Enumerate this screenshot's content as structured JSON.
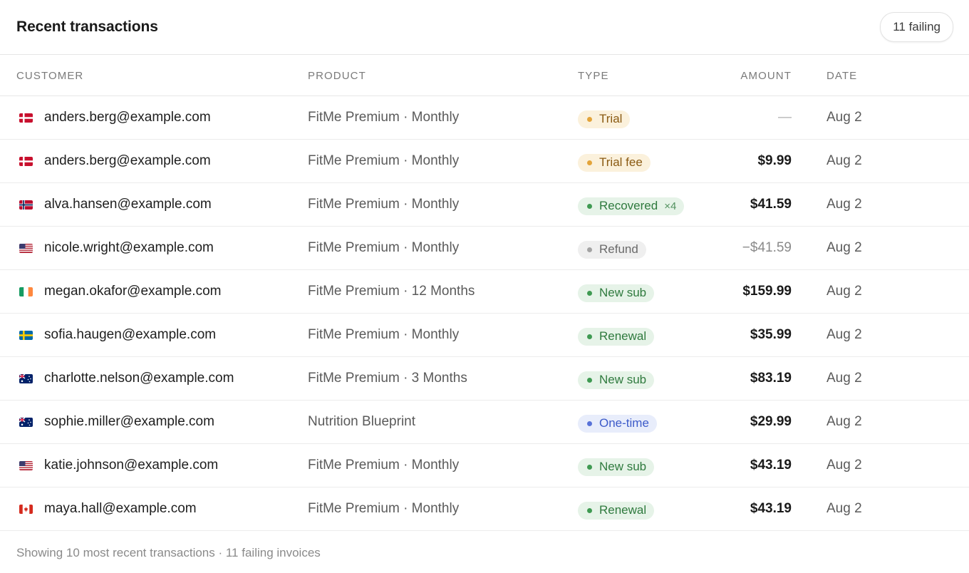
{
  "header": {
    "title": "Recent transactions",
    "failing_label": "11 failing"
  },
  "columns": {
    "customer": "Customer",
    "product": "Product",
    "type": "Type",
    "amount": "Amount",
    "date": "Date"
  },
  "rows": [
    {
      "flag": "dk",
      "email": "anders.berg@example.com",
      "product": "FitMe Premium · Monthly",
      "type": "Trial",
      "type_style": "trial",
      "multiplier": "",
      "amount": "—",
      "amount_style": "dash",
      "date": "Aug 2"
    },
    {
      "flag": "dk",
      "email": "anders.berg@example.com",
      "product": "FitMe Premium · Monthly",
      "type": "Trial fee",
      "type_style": "trial",
      "multiplier": "",
      "amount": "$9.99",
      "amount_style": "bold",
      "date": "Aug 2"
    },
    {
      "flag": "no",
      "email": "alva.hansen@example.com",
      "product": "FitMe Premium · Monthly",
      "type": "Recovered",
      "type_style": "recovered",
      "multiplier": "×4",
      "amount": "$41.59",
      "amount_style": "bold",
      "date": "Aug 2"
    },
    {
      "flag": "us",
      "email": "nicole.wright@example.com",
      "product": "FitMe Premium · Monthly",
      "type": "Refund",
      "type_style": "refund",
      "multiplier": "",
      "amount": "−$41.59",
      "amount_style": "muted",
      "date": "Aug 2"
    },
    {
      "flag": "ie",
      "email": "megan.okafor@example.com",
      "product": "FitMe Premium · 12 Months",
      "type": "New sub",
      "type_style": "green",
      "multiplier": "",
      "amount": "$159.99",
      "amount_style": "bold",
      "date": "Aug 2"
    },
    {
      "flag": "se",
      "email": "sofia.haugen@example.com",
      "product": "FitMe Premium · Monthly",
      "type": "Renewal",
      "type_style": "green",
      "multiplier": "",
      "amount": "$35.99",
      "amount_style": "bold",
      "date": "Aug 2"
    },
    {
      "flag": "au",
      "email": "charlotte.nelson@example.com",
      "product": "FitMe Premium · 3 Months",
      "type": "New sub",
      "type_style": "green",
      "multiplier": "",
      "amount": "$83.19",
      "amount_style": "bold",
      "date": "Aug 2"
    },
    {
      "flag": "au",
      "email": "sophie.miller@example.com",
      "product": "Nutrition Blueprint",
      "type": "One-time",
      "type_style": "onetime",
      "multiplier": "",
      "amount": "$29.99",
      "amount_style": "bold",
      "date": "Aug 2"
    },
    {
      "flag": "us",
      "email": "katie.johnson@example.com",
      "product": "FitMe Premium · Monthly",
      "type": "New sub",
      "type_style": "green",
      "multiplier": "",
      "amount": "$43.19",
      "amount_style": "bold",
      "date": "Aug 2"
    },
    {
      "flag": "ca",
      "email": "maya.hall@example.com",
      "product": "FitMe Premium · Monthly",
      "type": "Renewal",
      "type_style": "green",
      "multiplier": "",
      "amount": "$43.19",
      "amount_style": "bold",
      "date": "Aug 2"
    }
  ],
  "badge_colors": {
    "trial": {
      "bg": "#fbf1dc",
      "fg": "#8a5a12",
      "dot": "#e3a43a"
    },
    "recovered": {
      "bg": "#e6f3e8",
      "fg": "#2f7a3e",
      "dot": "#3f9a52"
    },
    "green": {
      "bg": "#e6f3e8",
      "fg": "#2f7a3e",
      "dot": "#3f9a52"
    },
    "refund": {
      "bg": "#efefef",
      "fg": "#6a6a6a",
      "dot": "#a3a3a3"
    },
    "onetime": {
      "bg": "#e8edfb",
      "fg": "#3d5bc9",
      "dot": "#5872d8"
    }
  },
  "footer": {
    "text": "Showing 10 most recent transactions · 11 failing invoices"
  }
}
